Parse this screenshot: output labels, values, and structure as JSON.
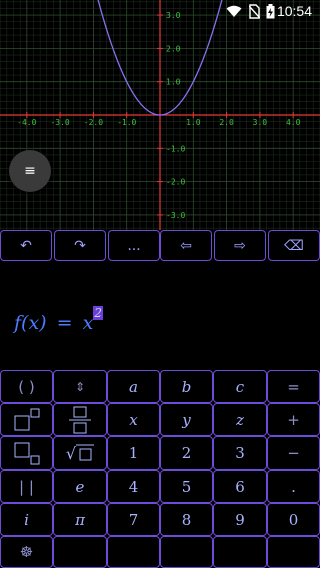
{
  "status_bar": {
    "time": "10:54",
    "icons": [
      "wifi-icon",
      "no-sim-icon",
      "battery-charging-icon"
    ]
  },
  "graph": {
    "x_ticks": [
      "-4.0",
      "-3.0",
      "-2.0",
      "-1.0",
      "1.0",
      "2.0",
      "3.0",
      "4.0"
    ],
    "y_ticks": [
      "3.0",
      "2.0",
      "1.0",
      "-1.0",
      "-2.0",
      "-3.0"
    ],
    "function": "x^2",
    "colors": {
      "axis": "#e53935",
      "grid_minor": "#1b2a1b",
      "grid_major": "#2c4a2c",
      "tick_label": "#3fbf3f",
      "curve": "#8a6ff0"
    }
  },
  "menu_button": {
    "icon": "menu-icon",
    "glyph": "≡"
  },
  "toolbar": {
    "undo": "↶",
    "redo": "↷",
    "more": "...",
    "left": "⇦",
    "right": "⇨",
    "backspace": "⌫"
  },
  "editor": {
    "lhs": "f(x)",
    "eq": "=",
    "base": "x",
    "exponent": "2"
  },
  "keypad": {
    "r1": [
      "( )",
      "⇕",
      "a",
      "b",
      "c",
      "="
    ],
    "r2": [
      "",
      "",
      "x",
      "y",
      "z",
      "+"
    ],
    "r3": [
      "",
      "√",
      "1",
      "2",
      "3",
      "−"
    ],
    "r4": [
      "| |",
      "e",
      "4",
      "5",
      "6",
      "."
    ],
    "r5": [
      "i",
      "π",
      "7",
      "8",
      "9",
      "0"
    ],
    "r6": [
      "☸",
      "",
      "",
      "",
      "",
      ""
    ]
  }
}
